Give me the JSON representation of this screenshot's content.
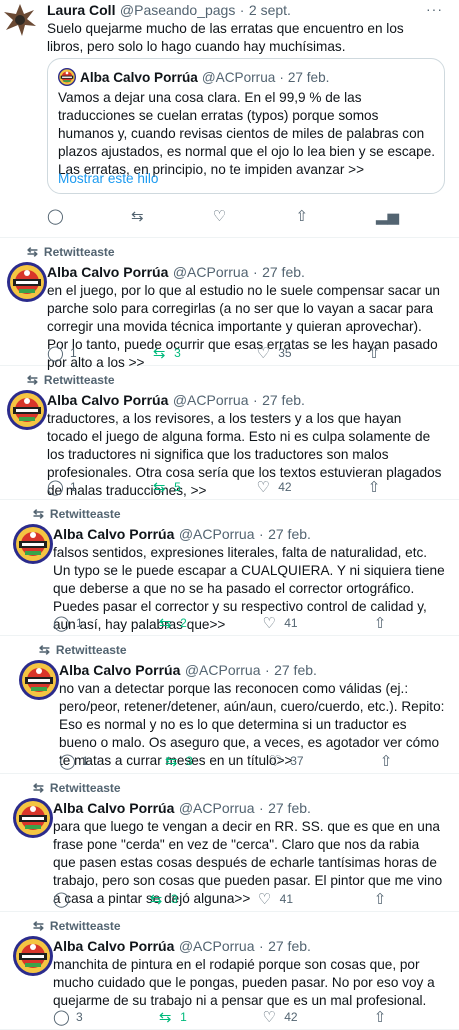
{
  "main_tweet": {
    "name": "Laura Coll",
    "handle": "@Paseando_pags",
    "dot": "·",
    "date": "2 sept.",
    "text": "Suelo quejarme mucho de las erratas que encuentro en los libros, pero solo lo hago cuando hay muchísimas.",
    "more": "···",
    "quote": {
      "name": "Alba Calvo Porrúa",
      "handle": "@ACPorrua",
      "dot": "·",
      "date": "27 feb.",
      "text": "Vamos a dejar una cosa clara. En el 99,9 % de las traducciones se cuelan erratas (typos) porque somos humanos y, cuando revisas cientos de miles de palabras con plazos ajustados, es normal que el ojo lo lea bien y se escape. Las erratas, en principio, no te impiden avanzar >>",
      "show_thread": "Mostrar este hilo"
    },
    "icons": {
      "reply": "comment-icon",
      "retweet": "retweet-icon",
      "like": "heart-icon",
      "share": "share-icon",
      "analytics": "analytics-icon"
    }
  },
  "retweet_label": "Retwitteaste",
  "author": {
    "name": "Alba Calvo Porrúa",
    "handle": "@ACPorrua",
    "dot": "·",
    "date": "27 feb."
  },
  "thread": [
    {
      "text": "en el juego, por lo que al estudio no le suele compensar sacar un parche solo para corregirlas (a no ser que lo vayan a sacar para corregir una movida técnica importante y quieran aprovechar). Por lo tanto, puede ocurrir que esas erratas se les hayan pasado por alto a los >>",
      "replies": "1",
      "retweets": "3",
      "likes": "35"
    },
    {
      "text": "traductores, a los revisores, a los testers y a los que hayan tocado el juego de alguna forma. Esto ni es culpa solamente de los traductores ni significa que los traductores son malos profesionales. Otra cosa sería que los textos estuvieran plagados de malas traducciones, >>",
      "replies": "1",
      "retweets": "5",
      "likes": "42"
    },
    {
      "text": "falsos sentidos, expresiones literales, falta de naturalidad, etc. Un typo se le puede escapar a CUALQUIERA. Y ni siquiera tiene que deberse a que no se ha pasado el corrector ortográfico. Puedes pasar el corrector y su respectivo control de calidad y, aun así, hay palabras que>>",
      "replies": "1",
      "retweets": "2",
      "likes": "41"
    },
    {
      "text": "no van a detectar porque las reconocen como válidas (ej.: pero/peor, retener/detener, aún/aun, cuero/cuerdo, etc.). Repito: Eso es normal y no es lo que determina si un traductor es bueno o malo. Os aseguro que, a veces, es agotador ver cómo te matas a currar meses en un título>>",
      "replies": "1",
      "retweets": "3",
      "likes": "37"
    },
    {
      "text": "para que luego te vengan a decir en RR. SS. que es que en una frase pone \"cerda\" en vez de \"cerca\". Claro que nos da rabia que pasen estas cosas después de echarle tantísimas horas de trabajo, pero son cosas que pueden pasar. El pintor que me vino a casa a pintar se dejó alguna>>",
      "replies": "",
      "retweets": "3",
      "likes": "41"
    },
    {
      "text": "manchita de pintura en el rodapié porque son cosas que, por mucho cuidado que le pongas, pueden pasar. No por eso voy a quejarme de su trabajo ni a pensar que es un mal profesional.",
      "replies": "3",
      "retweets": "1",
      "likes": "42"
    }
  ],
  "colors": {
    "retweet_green": "#00ba7c",
    "link_blue": "#1d9bf0",
    "muted": "#536471"
  }
}
